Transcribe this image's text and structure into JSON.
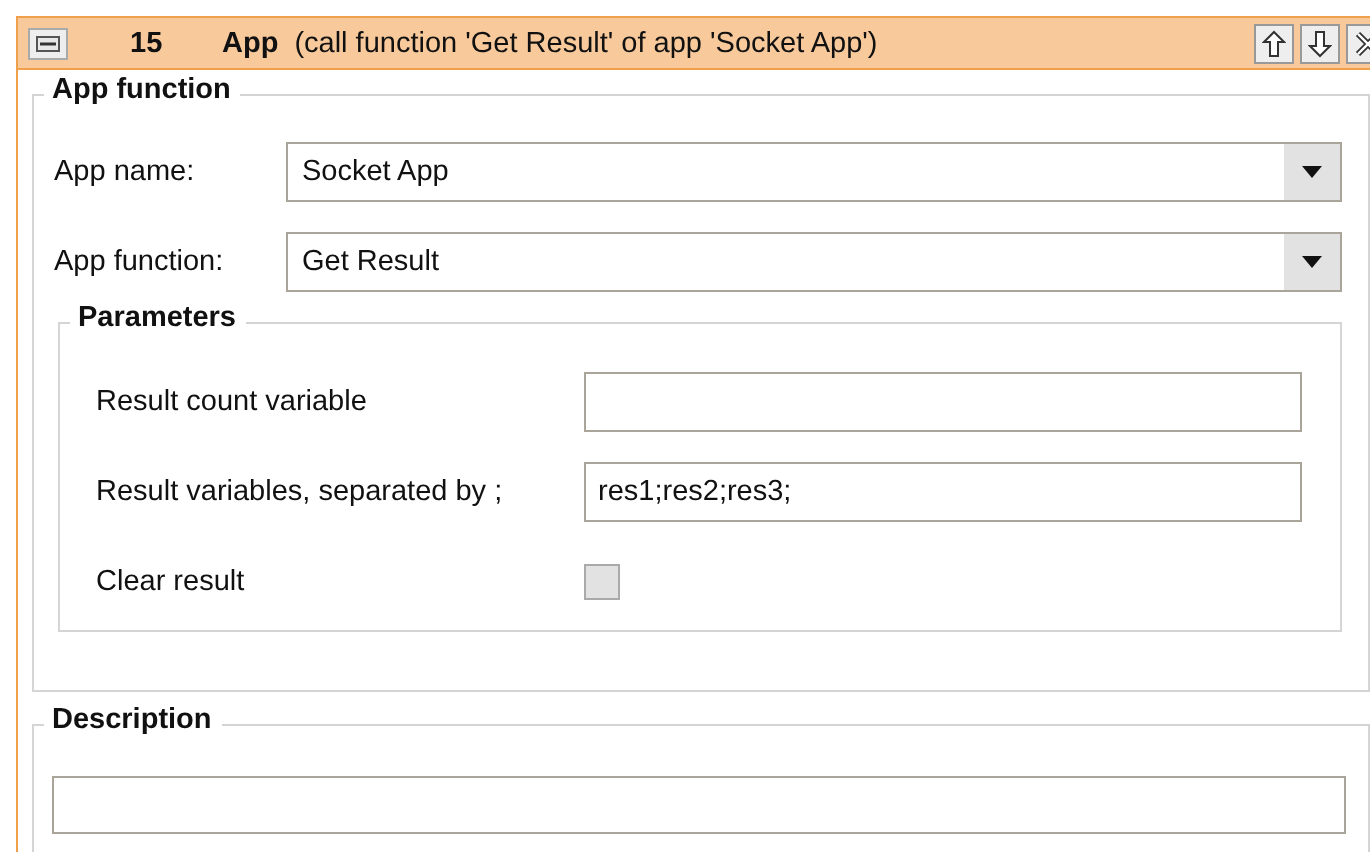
{
  "header": {
    "number": "15",
    "type": "App",
    "summary": "(call function 'Get Result' of app 'Socket App')"
  },
  "app_function": {
    "title": "App function",
    "fields": [
      {
        "label": "App name:",
        "value": "Socket App"
      },
      {
        "label": "App function:",
        "value": "Get Result"
      }
    ]
  },
  "parameters": {
    "title": "Parameters",
    "rows": [
      {
        "kind": "text",
        "label": "Result count variable",
        "value": ""
      },
      {
        "kind": "text",
        "label": "Result variables, separated by ;",
        "value": "res1;res2;res3;"
      },
      {
        "kind": "checkbox",
        "label": "Clear result",
        "checked": false
      }
    ]
  },
  "description": {
    "title": "Description"
  }
}
